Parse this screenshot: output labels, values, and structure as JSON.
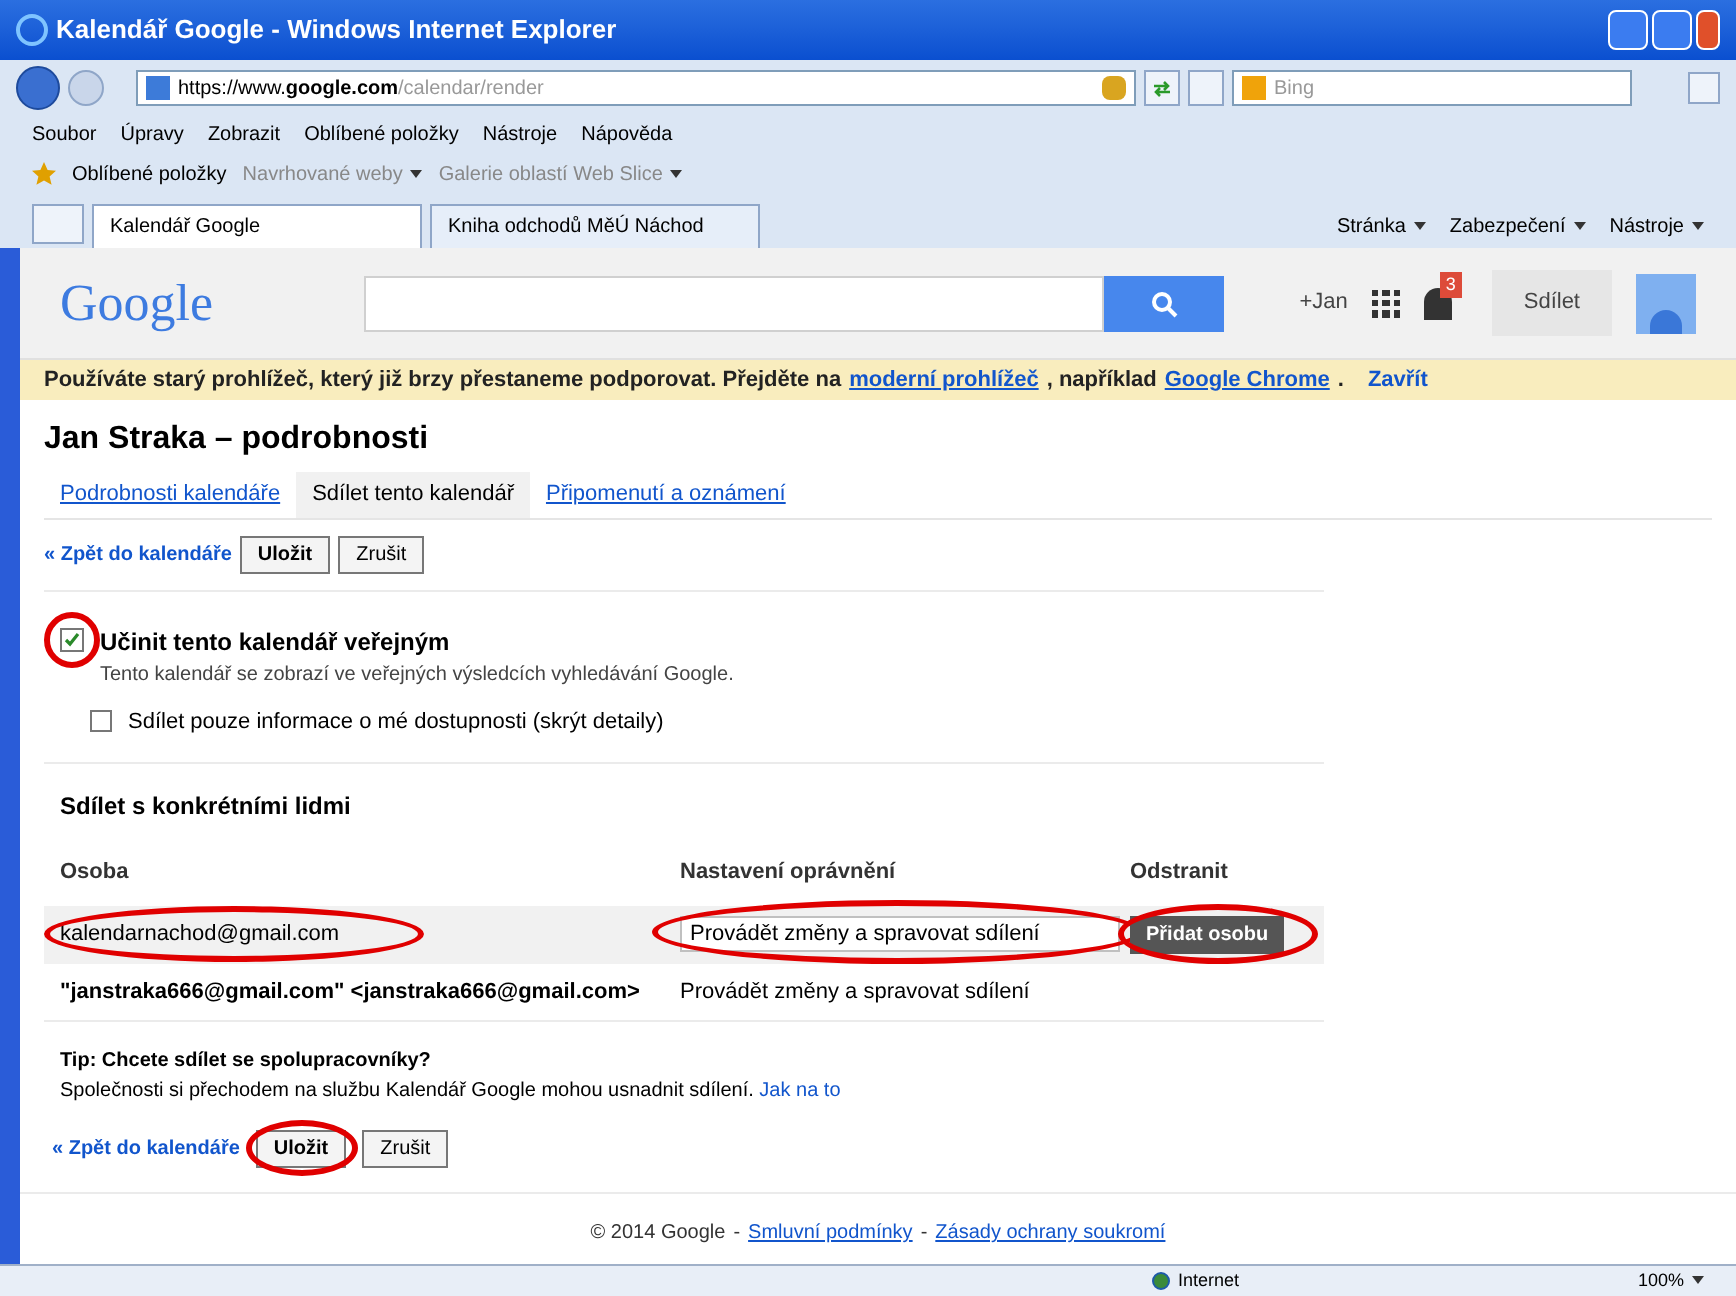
{
  "window": {
    "title": "Kalendář Google - Windows Internet Explorer"
  },
  "address_bar": {
    "url_prefix": "https://www.",
    "url_domain": "google.com",
    "url_path": "/calendar/render",
    "search_placeholder": "Bing"
  },
  "menu": [
    "Soubor",
    "Úpravy",
    "Zobrazit",
    "Oblíbené položky",
    "Nástroje",
    "Nápověda"
  ],
  "favorites_bar": {
    "favorites": "Oblíbené položky",
    "items": [
      "Navrhované weby",
      "Galerie oblastí Web Slice"
    ]
  },
  "browser_tabs": [
    {
      "label": "Kalendář Google",
      "selected": true
    },
    {
      "label": "Kniha odchodů MěÚ Náchod",
      "selected": false
    }
  ],
  "command_bar": [
    "Stránka",
    "Zabezpečení",
    "Nástroje"
  ],
  "google_header": {
    "logo": "Google",
    "user": "+Jan",
    "notifications": "3",
    "share": "Sdílet"
  },
  "banner": {
    "text": "Používáte starý prohlížeč, který již brzy přestaneme podporovat. Přejděte na",
    "link1": "moderní prohlížeč",
    "middle": ", například",
    "link2": "Google Chrome",
    "end": ".",
    "close": "Zavřít"
  },
  "page_title": "Jan Straka – podrobnosti",
  "tabs": [
    {
      "label": "Podrobnosti kalendáře",
      "selected": false
    },
    {
      "label": "Sdílet tento kalendář",
      "selected": true
    },
    {
      "label": "Připomenutí a oznámení",
      "selected": false
    }
  ],
  "actions": {
    "back": "« Zpět do kalendáře",
    "save": "Uložit",
    "cancel": "Zrušit"
  },
  "public": {
    "label": "Učinit tento kalendář veřejným",
    "checked": true,
    "hint": "Tento kalendář se zobrazí ve veřejných výsledcích vyhledávání Google.",
    "busy_only": {
      "label": "Sdílet pouze informace o mé dostupnosti (skrýt detaily)",
      "checked": false
    }
  },
  "share": {
    "heading": "Sdílet s konkrétními lidmi",
    "columns": [
      "Osoba",
      "Nastavení oprávnění",
      "Odstranit"
    ],
    "new_person": "kalendarnachod@gmail.com",
    "new_permission": "Provádět změny a spravovat sdílení",
    "add_button": "Přidat osobu",
    "rows": [
      {
        "person": "\"janstraka666@gmail.com\" <janstraka666@gmail.com>",
        "permission": "Provádět změny a spravovat sdílení"
      }
    ]
  },
  "tip": {
    "title": "Tip: Chcete sdílet se spolupracovníky?",
    "text": "Společnosti si přechodem na službu Kalendář Google mohou usnadnit sdílení.",
    "link": "Jak na to"
  },
  "bottom_actions": {
    "back": "« Zpět do kalendáře",
    "save": "Uložit",
    "cancel": "Zrušit"
  },
  "footer": {
    "copyright": "© 2014 Google",
    "sep": "-",
    "terms": "Smluvní podmínky",
    "privacy": "Zásady ochrany soukromí"
  },
  "status_bar": {
    "zone": "Internet",
    "zoom": "100%"
  }
}
